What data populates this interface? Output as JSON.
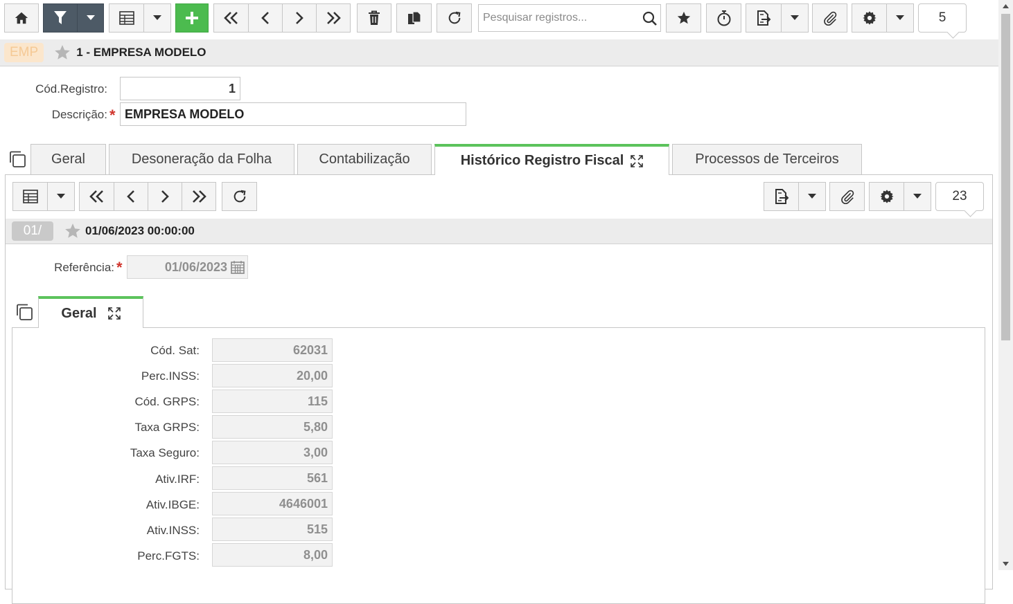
{
  "toolbar": {
    "search_placeholder": "Pesquisar registros...",
    "counter": "5"
  },
  "record": {
    "badge": "EMP",
    "title": "1 - EMPRESA MODELO",
    "cod_label": "Cód.Registro:",
    "cod_value": "1",
    "desc_label": "Descrição:",
    "desc_value": "EMPRESA MODELO",
    "required_mark": "*"
  },
  "tabs": [
    {
      "label": "Geral"
    },
    {
      "label": "Desoneração da Folha"
    },
    {
      "label": "Contabilização"
    },
    {
      "label": "Histórico Registro Fiscal",
      "active": true
    },
    {
      "label": "Processos de Terceiros"
    }
  ],
  "subtoolbar": {
    "counter": "23"
  },
  "subrecord": {
    "badge": "01/",
    "title": "01/06/2023 00:00:00",
    "ref_label": "Referência:",
    "ref_value": "01/06/2023"
  },
  "innertab": {
    "label": "Geral"
  },
  "fields": [
    {
      "label": "Cód. Sat:",
      "value": "62031"
    },
    {
      "label": "Perc.INSS:",
      "value": "20,00"
    },
    {
      "label": "Cód. GRPS:",
      "value": "115"
    },
    {
      "label": "Taxa GRPS:",
      "value": "5,80"
    },
    {
      "label": "Taxa Seguro:",
      "value": "3,00"
    },
    {
      "label": "Ativ.IRF:",
      "value": "561"
    },
    {
      "label": "Ativ.IBGE:",
      "value": "4646001"
    },
    {
      "label": "Ativ.INSS:",
      "value": "515"
    },
    {
      "label": "Perc.FGTS:",
      "value": "8,00"
    }
  ],
  "colors": {
    "accent_green": "#4cbb4f",
    "tab_active_border": "#5cc35c",
    "filter_dark": "#4d5a66",
    "required_red": "#d0342c",
    "emp_badge_bg": "#fbe6cc",
    "emp_badge_text": "#f5c995"
  }
}
